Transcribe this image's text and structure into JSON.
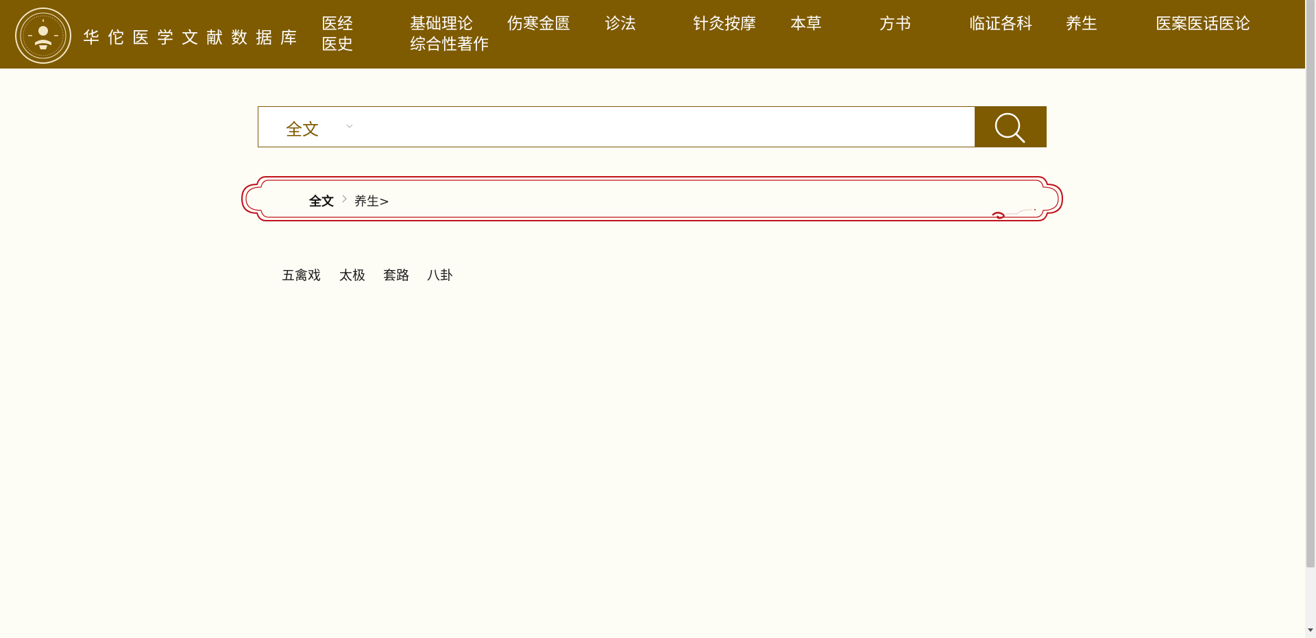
{
  "header": {
    "title": "华佗医学文献数据库",
    "brand_color": "#7e5a00",
    "logo_icon": "seal-logo",
    "nav": [
      {
        "label": "医经",
        "label2": "医史"
      },
      {
        "label": "基础理论",
        "label2": "综合性著作"
      },
      {
        "label": "伤寒金匮"
      },
      {
        "label": "诊法"
      },
      {
        "label": "针灸按摩"
      },
      {
        "label": "本草"
      },
      {
        "label": "方书"
      },
      {
        "label": "临证各科"
      },
      {
        "label": "养生"
      },
      {
        "label": "医案医话医论"
      }
    ]
  },
  "search": {
    "scope": "全文",
    "value": "",
    "placeholder": "",
    "button_icon": "search-icon"
  },
  "breadcrumb": {
    "root": "全文",
    "current": "养生>",
    "frame_color": "#c0101c"
  },
  "subcategories": [
    "五禽戏",
    "太极",
    "套路",
    "八卦"
  ]
}
